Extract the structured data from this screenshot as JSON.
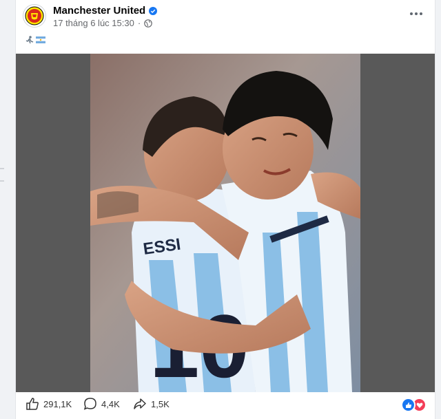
{
  "post": {
    "page_name": "Manchester United",
    "timestamp": "17 tháng 6 lúc 15:30",
    "caption_icons": [
      "running-person-icon",
      "argentina-flag-icon"
    ],
    "photo_icon": "football-players-embrace-photo"
  },
  "footer": {
    "likes": "291,1K",
    "comments": "4,4K",
    "shares": "1,5K",
    "reactions": [
      "like-icon",
      "love-icon"
    ]
  },
  "colors": {
    "brand_blue": "#1877f2",
    "love_red": "#f33e58",
    "meta_gray": "#65676b",
    "media_bg": "#595959"
  }
}
